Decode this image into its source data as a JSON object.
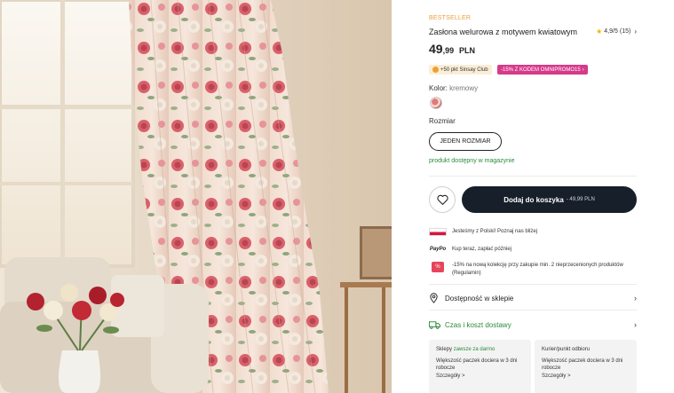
{
  "product": {
    "badge": "BESTSELLER",
    "title": "Zasłona welurowa z motywem kwiatowym",
    "rating_value": "4,9/5",
    "rating_count": "(15)",
    "price_main": "49",
    "price_cents": ",99",
    "price_currency": "PLN",
    "club_badge": "+50 pkt Sinsay Club",
    "promo_badge": "-15% Z KODEM OMNIPROMO15",
    "color_label": "Kolor:",
    "color_value": "kremowy",
    "size_label": "Rozmiar",
    "size_option": "JEDEN ROZMIAR",
    "stock_text": "produkt dostępny w magazynie"
  },
  "cart": {
    "button_label": "Dodaj do koszyka",
    "button_price": "- 49,99 PLN"
  },
  "info": [
    {
      "icon": "polish-flag-icon",
      "text": "Jesteśmy z Polski! Poznaj nas bliżej"
    },
    {
      "icon": "paypo-icon",
      "icon_text": "PayPo",
      "text": "Kup teraz, zapłać później"
    },
    {
      "icon": "price-tag-icon",
      "text": "-15% na nową kolekcję przy zakupie min. 2 nieprzecenionych produktów (Regulamin)"
    }
  ],
  "links": {
    "availability": "Dostępność w sklepie",
    "delivery": "Czas i koszt dostawy"
  },
  "delivery_cards": [
    {
      "title": "Sklepy",
      "highlight": "zawsze za darmo",
      "body": "Większość paczek dociera w 3 dni robocze",
      "more": "Szczegóły >"
    },
    {
      "title": "Kurier/punkt odbioru",
      "highlight": "",
      "body": "Większość paczek dociera w 3 dni robocze",
      "more": "Szczegóły >"
    }
  ],
  "colors": {
    "accent_orange": "#e8a03a",
    "promo_pink": "#d63a8a",
    "cart_dark": "#17202a",
    "stock_green": "#2a8a3a"
  }
}
